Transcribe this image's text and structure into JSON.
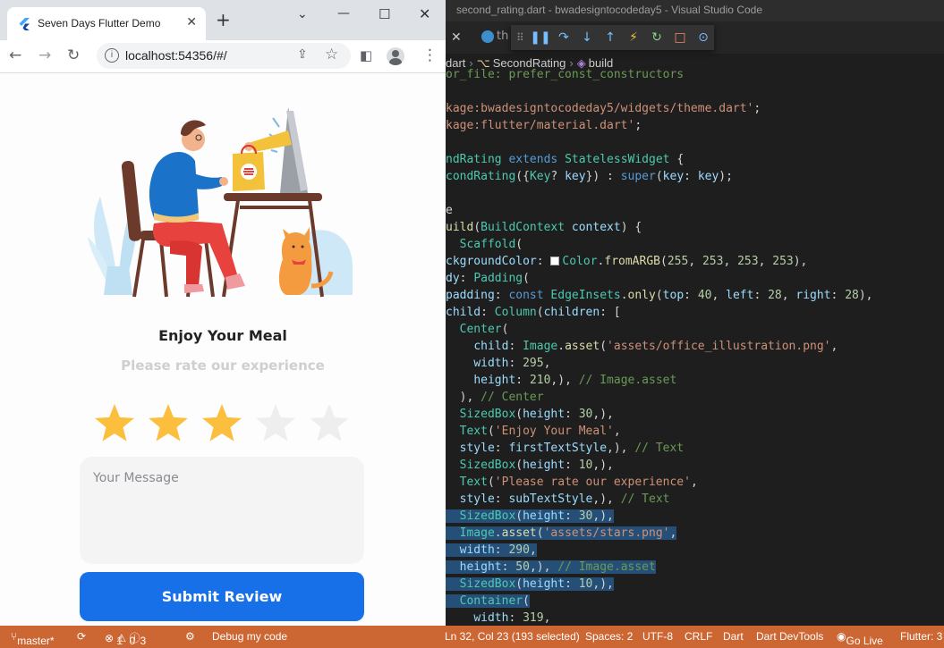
{
  "browser": {
    "tab_title": "Seven Days Flutter Demo",
    "url": "localhost:54356/#/"
  },
  "app": {
    "title": "Enjoy Your Meal",
    "subtitle": "Please rate our experience",
    "rating": {
      "value": 3,
      "max": 5,
      "filled_color": "#fbbf3d",
      "empty_color": "#eeeeee"
    },
    "message_placeholder": "Your Message",
    "submit_label": "Submit Review",
    "accent": "#1770e8"
  },
  "vscode": {
    "window_title": "second_rating.dart - bwadesigntocodeday5 - Visual Studio Code",
    "tab_label": "th",
    "breadcrumb": [
      "dart",
      "SecondRating",
      "build"
    ],
    "code_lines": [
      [
        [
          "c",
          "or_file: prefer_const_constructors"
        ]
      ],
      [],
      [
        [
          "s",
          "kage:bwadesigntocodeday5/widgets/theme.dart'"
        ],
        [
          "o",
          ";"
        ]
      ],
      [
        [
          "s",
          "kage:flutter/material.dart'"
        ],
        [
          "o",
          ";"
        ]
      ],
      [],
      [
        [
          "ty",
          "ndRating "
        ],
        [
          "k",
          "extends "
        ],
        [
          "ty",
          "StatelessWidget "
        ],
        [
          "o",
          "{"
        ]
      ],
      [
        [
          "ty",
          "condRating"
        ],
        [
          "o",
          "({"
        ],
        [
          "ty",
          "Key"
        ],
        [
          "o",
          "? "
        ],
        [
          "p",
          "key"
        ],
        [
          "o",
          "}) : "
        ],
        [
          "k",
          "super"
        ],
        [
          "o",
          "("
        ],
        [
          "p",
          "key"
        ],
        [
          "o",
          ": "
        ],
        [
          "p",
          "key"
        ],
        [
          "o",
          ");"
        ]
      ],
      [],
      [
        [
          "o",
          "e"
        ]
      ],
      [
        [
          "f",
          "uild"
        ],
        [
          "o",
          "("
        ],
        [
          "ty",
          "BuildContext "
        ],
        [
          "p",
          "context"
        ],
        [
          "o",
          ") {"
        ]
      ],
      [
        [
          "o",
          "  "
        ],
        [
          "ty",
          "Scaffold"
        ],
        [
          "o",
          "("
        ]
      ],
      [
        [
          "p",
          "ckgroundColor"
        ],
        [
          "o",
          ": "
        ],
        [
          "sw",
          ""
        ],
        [
          "ty",
          "Color"
        ],
        [
          "o",
          "."
        ],
        [
          "f",
          "fromARGB"
        ],
        [
          "o",
          "("
        ],
        [
          "n",
          "255"
        ],
        [
          "o",
          ", "
        ],
        [
          "n",
          "253"
        ],
        [
          "o",
          ", "
        ],
        [
          "n",
          "253"
        ],
        [
          "o",
          ", "
        ],
        [
          "n",
          "253"
        ],
        [
          "o",
          "),"
        ]
      ],
      [
        [
          "p",
          "dy"
        ],
        [
          "o",
          ": "
        ],
        [
          "ty",
          "Padding"
        ],
        [
          "o",
          "("
        ]
      ],
      [
        [
          "p",
          "padding"
        ],
        [
          "o",
          ": "
        ],
        [
          "k",
          "const "
        ],
        [
          "ty",
          "EdgeInsets"
        ],
        [
          "o",
          "."
        ],
        [
          "f",
          "only"
        ],
        [
          "o",
          "("
        ],
        [
          "p",
          "top"
        ],
        [
          "o",
          ": "
        ],
        [
          "n",
          "40"
        ],
        [
          "o",
          ", "
        ],
        [
          "p",
          "left"
        ],
        [
          "o",
          ": "
        ],
        [
          "n",
          "28"
        ],
        [
          "o",
          ", "
        ],
        [
          "p",
          "right"
        ],
        [
          "o",
          ": "
        ],
        [
          "n",
          "28"
        ],
        [
          "o",
          "),"
        ]
      ],
      [
        [
          "p",
          "child"
        ],
        [
          "o",
          ": "
        ],
        [
          "ty",
          "Column"
        ],
        [
          "o",
          "("
        ],
        [
          "p",
          "children"
        ],
        [
          "o",
          ": ["
        ]
      ],
      [
        [
          "o",
          "  "
        ],
        [
          "ty",
          "Center"
        ],
        [
          "o",
          "("
        ]
      ],
      [
        [
          "o",
          "    "
        ],
        [
          "p",
          "child"
        ],
        [
          "o",
          ": "
        ],
        [
          "ty",
          "Image"
        ],
        [
          "o",
          "."
        ],
        [
          "f",
          "asset"
        ],
        [
          "o",
          "("
        ],
        [
          "s",
          "'assets/office_illustration.png'"
        ],
        [
          "o",
          ","
        ]
      ],
      [
        [
          "o",
          "    "
        ],
        [
          "p",
          "width"
        ],
        [
          "o",
          ": "
        ],
        [
          "n",
          "295"
        ],
        [
          "o",
          ","
        ]
      ],
      [
        [
          "o",
          "    "
        ],
        [
          "p",
          "height"
        ],
        [
          "o",
          ": "
        ],
        [
          "n",
          "210"
        ],
        [
          "o",
          ",), "
        ],
        [
          "c",
          "// Image.asset"
        ]
      ],
      [
        [
          "o",
          "  ), "
        ],
        [
          "c",
          "// Center"
        ]
      ],
      [
        [
          "o",
          "  "
        ],
        [
          "ty",
          "SizedBox"
        ],
        [
          "o",
          "("
        ],
        [
          "p",
          "height"
        ],
        [
          "o",
          ": "
        ],
        [
          "n",
          "30"
        ],
        [
          "o",
          ",),"
        ]
      ],
      [
        [
          "o",
          "  "
        ],
        [
          "ty",
          "Text"
        ],
        [
          "o",
          "("
        ],
        [
          "s",
          "'Enjoy Your Meal'"
        ],
        [
          "o",
          ","
        ]
      ],
      [
        [
          "o",
          "  "
        ],
        [
          "p",
          "style"
        ],
        [
          "o",
          ": "
        ],
        [
          "p",
          "firstTextStyle"
        ],
        [
          "o",
          ",), "
        ],
        [
          "c",
          "// Text"
        ]
      ],
      [
        [
          "o",
          "  "
        ],
        [
          "ty",
          "SizedBox"
        ],
        [
          "o",
          "("
        ],
        [
          "p",
          "height"
        ],
        [
          "o",
          ": "
        ],
        [
          "n",
          "10"
        ],
        [
          "o",
          ",),"
        ]
      ],
      [
        [
          "o",
          "  "
        ],
        [
          "ty",
          "Text"
        ],
        [
          "o",
          "("
        ],
        [
          "s",
          "'Please rate our experience'"
        ],
        [
          "o",
          ","
        ]
      ],
      [
        [
          "o",
          "  "
        ],
        [
          "p",
          "style"
        ],
        [
          "o",
          ": "
        ],
        [
          "p",
          "subTextStyle"
        ],
        [
          "o",
          ",), "
        ],
        [
          "c",
          "// Text"
        ]
      ],
      [
        [
          "o",
          "  "
        ],
        [
          "ty",
          "SizedBox"
        ],
        [
          "o",
          "("
        ],
        [
          "p",
          "height"
        ],
        [
          "o",
          ": "
        ],
        [
          "n",
          "30"
        ],
        [
          "o",
          ",),"
        ]
      ],
      [
        [
          "o",
          "  "
        ],
        [
          "ty",
          "Image"
        ],
        [
          "o",
          "."
        ],
        [
          "f",
          "asset"
        ],
        [
          "o",
          "("
        ],
        [
          "s",
          "'assets/stars.png'"
        ],
        [
          "o",
          ","
        ]
      ],
      [
        [
          "o",
          "  "
        ],
        [
          "p",
          "width"
        ],
        [
          "o",
          ": "
        ],
        [
          "n",
          "290"
        ],
        [
          "o",
          ","
        ]
      ],
      [
        [
          "o",
          "  "
        ],
        [
          "p",
          "height"
        ],
        [
          "o",
          ": "
        ],
        [
          "n",
          "50"
        ],
        [
          "o",
          ",), "
        ],
        [
          "c",
          "// Image.asset"
        ]
      ],
      [
        [
          "o",
          "  "
        ],
        [
          "ty",
          "SizedBox"
        ],
        [
          "o",
          "("
        ],
        [
          "p",
          "height"
        ],
        [
          "o",
          ": "
        ],
        [
          "n",
          "10"
        ],
        [
          "o",
          ",),"
        ]
      ],
      [
        [
          "o",
          "  "
        ],
        [
          "ty",
          "Container"
        ],
        [
          "o",
          "("
        ]
      ],
      [
        [
          "o",
          "    "
        ],
        [
          "p",
          "width"
        ],
        [
          "o",
          ": "
        ],
        [
          "n",
          "319"
        ],
        [
          "o",
          ","
        ]
      ]
    ],
    "selected_line_indices": [
      26,
      27,
      28,
      29,
      30,
      31
    ],
    "status": {
      "branch": "master*",
      "errors": "1",
      "warnings": "0",
      "infos": "3",
      "debug": "Debug my code",
      "cursor": "Ln 32, Col 23 (193 selected)",
      "spaces": "Spaces: 2",
      "encoding": "UTF-8",
      "eol": "CRLF",
      "lang": "Dart",
      "devtools": "Dart DevTools",
      "golive": "Go Live",
      "flutter": "Flutter: 3"
    }
  }
}
